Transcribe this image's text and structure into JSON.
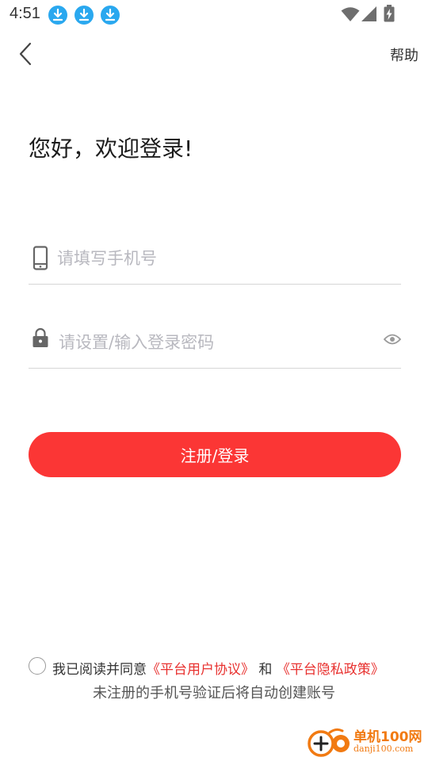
{
  "status_bar": {
    "time": "4:51",
    "notification_icons": [
      "download-icon",
      "download-icon",
      "download-icon"
    ],
    "right_icons": [
      "wifi-icon",
      "cell-signal-icon",
      "battery-charging-icon"
    ]
  },
  "topbar": {
    "back_icon": "chevron-left-icon",
    "help_label": "帮助"
  },
  "greeting": "您好，欢迎登录!",
  "phone_field": {
    "icon": "phone-icon",
    "value": "",
    "placeholder": "请填写手机号"
  },
  "password_field": {
    "icon": "lock-icon",
    "value": "",
    "placeholder": "请设置/输入登录密码",
    "toggle_icon": "eye-icon"
  },
  "login_button": {
    "label": "注册/登录"
  },
  "agreement": {
    "prefix": "我已阅读并同意",
    "user_agreement": "《平台用户协议》",
    "conjunction": "和",
    "privacy_policy": "《平台隐私政策》",
    "checked": false
  },
  "hint": "未注册的手机号验证后将自动创建账号",
  "watermark": {
    "title": "单机100网",
    "url": "danji100.com"
  },
  "colors": {
    "accent": "#fb3635",
    "link": "#e8312f",
    "download_badge": "#2aa8ef",
    "watermark": "#f17a12"
  }
}
